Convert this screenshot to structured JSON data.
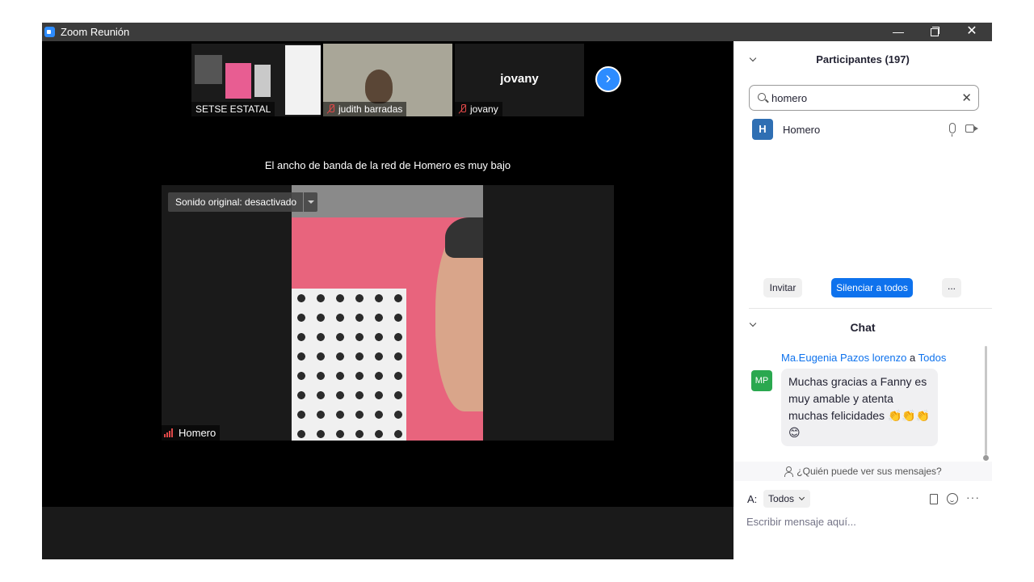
{
  "window": {
    "title": "Zoom Reunión",
    "minimize": "—",
    "close": "✕"
  },
  "thumbnails": [
    {
      "name": "SETSE ESTATAL",
      "muted": false
    },
    {
      "name": "judith barradas",
      "muted": true
    },
    {
      "name": "jovany",
      "display_name": "jovany",
      "muted": true
    }
  ],
  "next_button": "›",
  "main": {
    "bandwidth_message": "El ancho de banda de la red de Homero es muy bajo",
    "original_sound": "Sonido original: desactivado",
    "speaker_name": "Homero"
  },
  "participants": {
    "title": "Participantes (197)",
    "search_value": "homero",
    "clear_icon": "✕",
    "items": [
      {
        "initial": "H",
        "name": "Homero"
      }
    ],
    "invite_label": "Invitar",
    "mute_all_label": "Silenciar a todos",
    "more_label": "..."
  },
  "chat": {
    "title": "Chat",
    "messages": [
      {
        "initials": "MP",
        "sender": "Ma.Eugenia Pazos lorenzo",
        "connector": "a",
        "recipient": "Todos",
        "text": "Muchas gracias a Fanny es muy amable y atenta muchas felicidades 👏👏👏😊"
      }
    ],
    "who_can_see": "¿Quién puede ver sus mensajes?",
    "to_label": "A:",
    "to_value": "Todos",
    "more_icon": "···",
    "input_placeholder": "Escribir mensaje aquí..."
  },
  "colors": {
    "accent": "#0e72ed",
    "zoom_blue": "#2d8cff",
    "muted_red": "#e04848",
    "avatar_mp": "#2aa84f",
    "avatar_h": "#2f6fb3"
  }
}
